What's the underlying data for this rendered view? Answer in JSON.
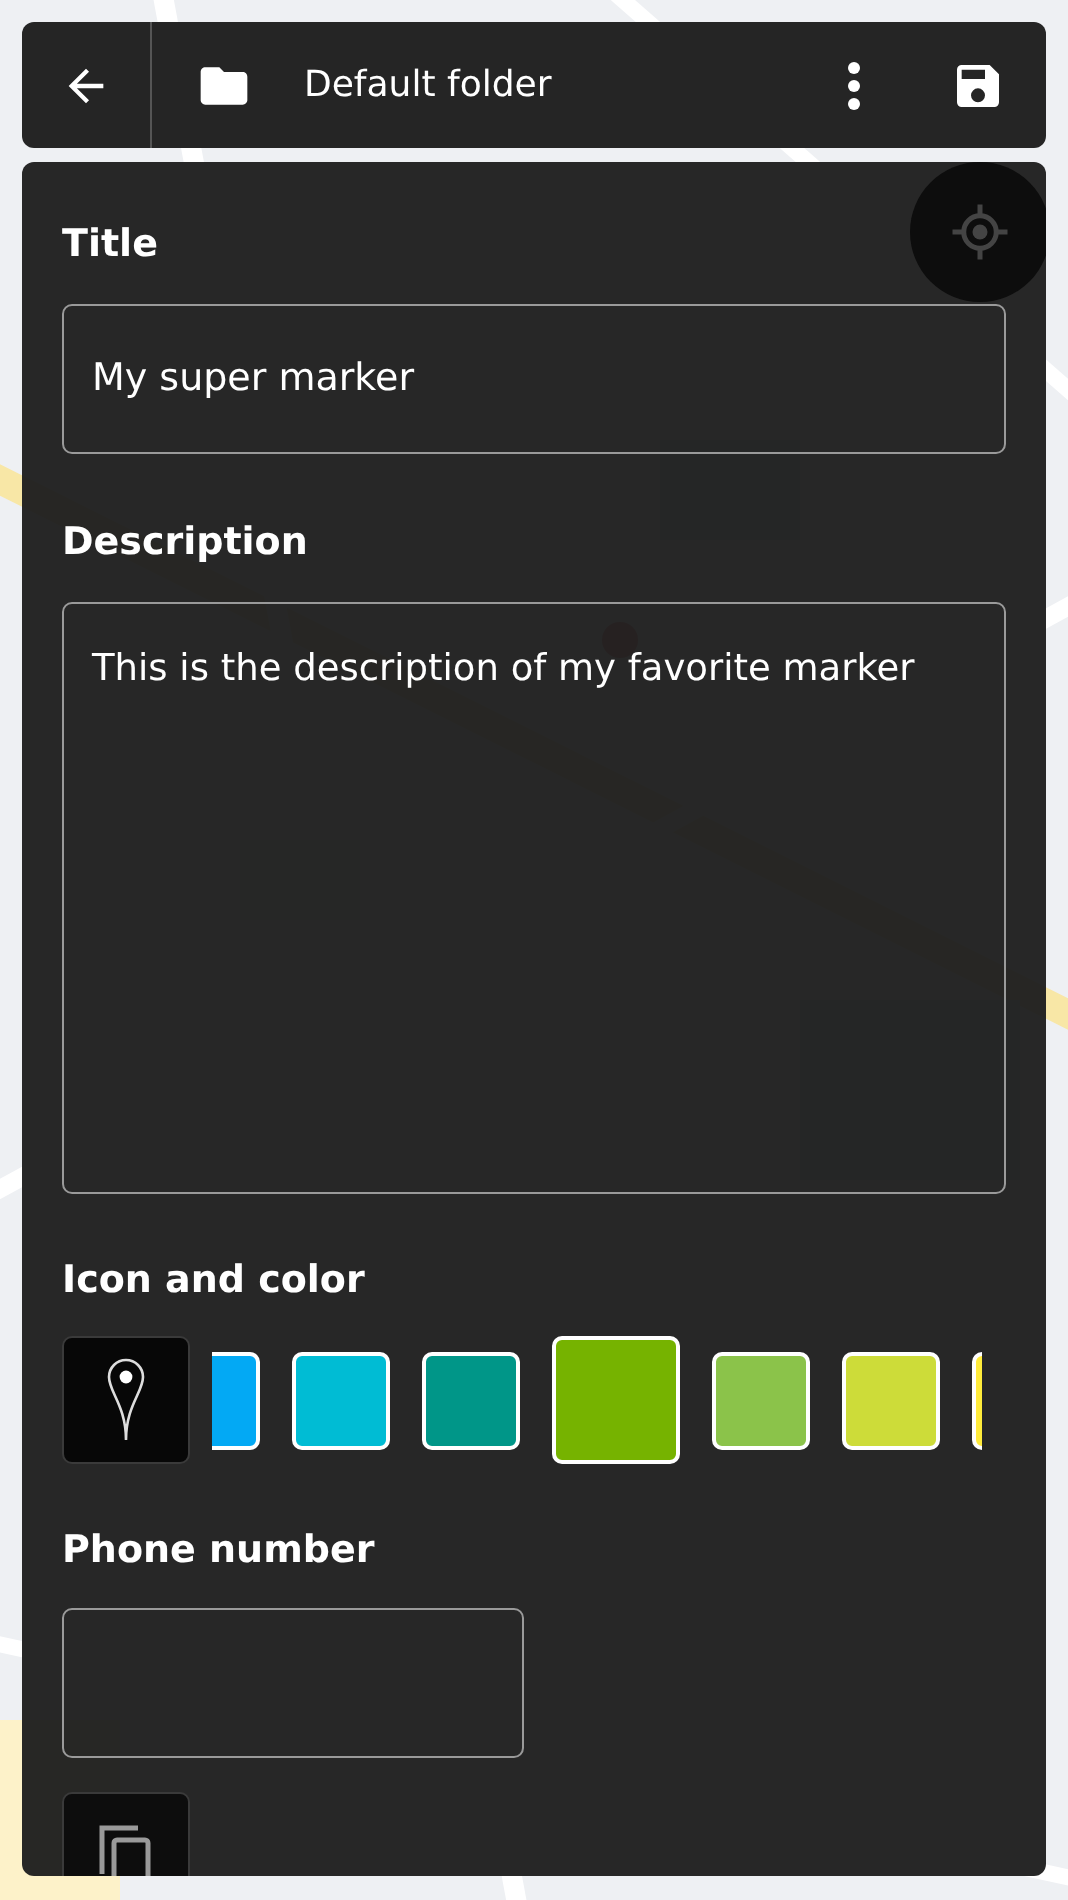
{
  "top_bar": {
    "folder_name": "Default folder"
  },
  "form": {
    "title": {
      "label": "Title",
      "value": "My super marker"
    },
    "description": {
      "label": "Description",
      "value": "This is the description of my favorite marker"
    },
    "icon_and_color": {
      "label": "Icon and color",
      "colors": [
        {
          "color": "#03a9f4",
          "selected": false
        },
        {
          "color": "#00bcd4",
          "selected": false
        },
        {
          "color": "#009688",
          "selected": false
        },
        {
          "color": "#76b300",
          "selected": true
        },
        {
          "color": "#8bc34a",
          "selected": false
        },
        {
          "color": "#cddc39",
          "selected": false
        },
        {
          "color": "#ffeb3b",
          "selected": false
        }
      ]
    },
    "phone": {
      "label": "Phone number"
    }
  }
}
